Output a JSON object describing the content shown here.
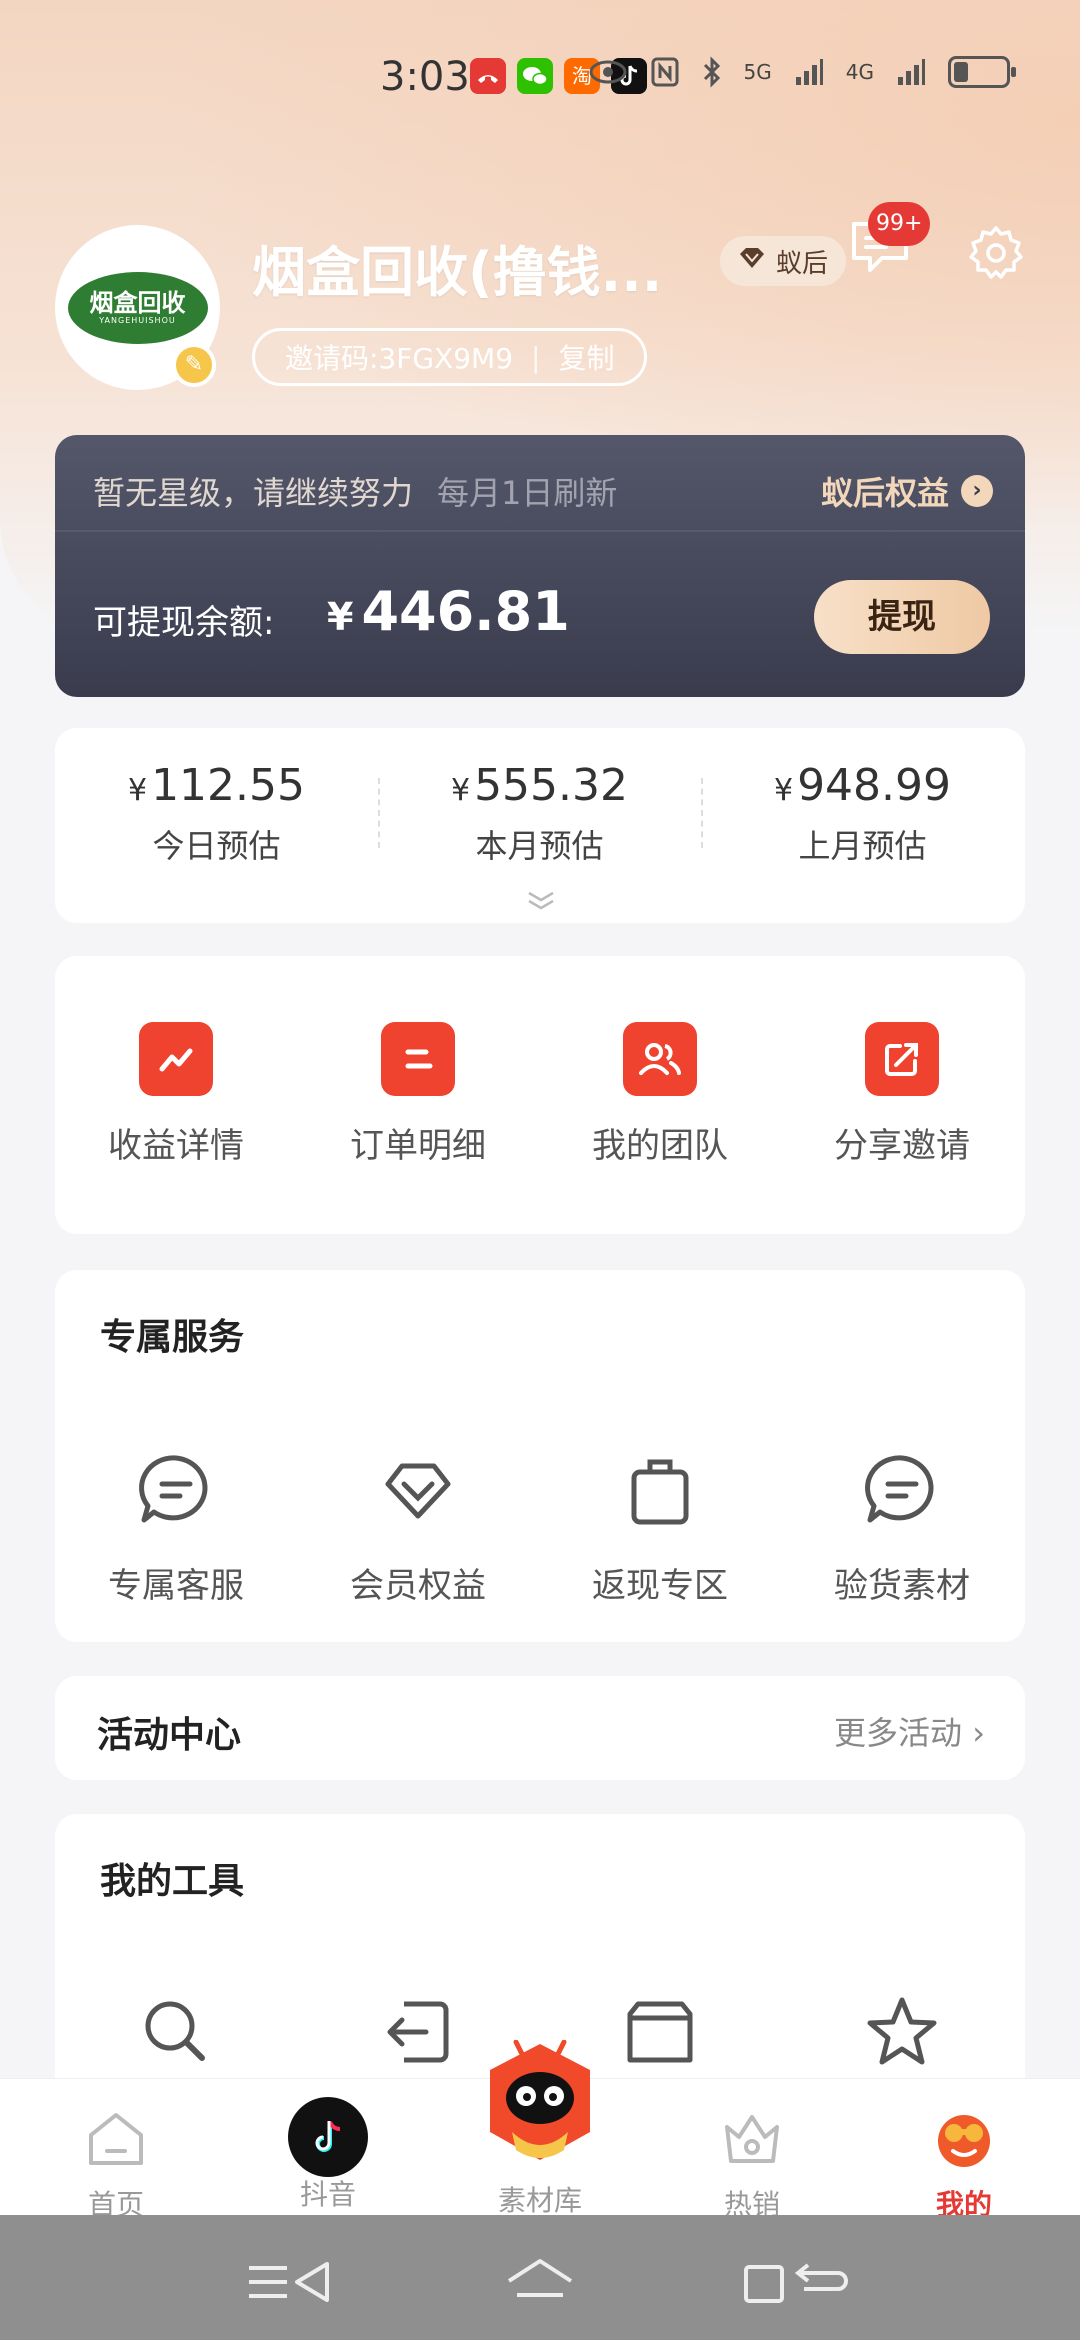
{
  "status_bar": {
    "time": "3:03",
    "apps": [
      "missed-call-icon",
      "wechat-icon",
      "taobao-icon",
      "tiktok-icon"
    ],
    "taobao_glyph": "淘",
    "network": "5G",
    "network2": "4G"
  },
  "profile": {
    "name": "烟盒回收(撸钱...",
    "logo_text": "烟盒回收",
    "logo_subtext": "YANGEHUISHOU",
    "invite_label": "邀请码:3FGX9M9",
    "invite_separator": "|",
    "copy_label": "复制",
    "level": "蚁后",
    "message_badge": "99+"
  },
  "balance_card": {
    "star_note": "暂无星级，请继续努力",
    "refresh_note": "每月1日刷新",
    "rights_label": "蚁后权益",
    "balance_label": "可提现余额:",
    "currency": "¥",
    "balance": "446.81",
    "withdraw_label": "提现"
  },
  "estimates": [
    {
      "currency": "¥",
      "value": "112.55",
      "label": "今日预估"
    },
    {
      "currency": "¥",
      "value": "555.32",
      "label": "本月预估"
    },
    {
      "currency": "¥",
      "value": "948.99",
      "label": "上月预估"
    }
  ],
  "quick_actions": [
    {
      "label": "收益详情",
      "icon": "trend-icon"
    },
    {
      "label": "订单明细",
      "icon": "list-icon"
    },
    {
      "label": "我的团队",
      "icon": "team-icon"
    },
    {
      "label": "分享邀请",
      "icon": "share-icon"
    }
  ],
  "services": {
    "title": "专属服务",
    "items": [
      {
        "label": "专属客服",
        "icon": "chat-bubble-icon"
      },
      {
        "label": "会员权益",
        "icon": "diamond-icon"
      },
      {
        "label": "返现专区",
        "icon": "shopping-bag-icon"
      },
      {
        "label": "验货素材",
        "icon": "chat-bubble-icon"
      }
    ]
  },
  "activity": {
    "title": "活动中心",
    "more_label": "更多活动"
  },
  "tools": {
    "title": "我的工具",
    "items": [
      {
        "icon": "search-icon"
      },
      {
        "icon": "return-icon"
      },
      {
        "icon": "box-icon"
      },
      {
        "icon": "star-icon"
      }
    ]
  },
  "bottom_nav": [
    {
      "label": "首页",
      "icon": "home-icon",
      "active": false
    },
    {
      "label": "抖音",
      "icon": "tiktok-icon",
      "active": false
    },
    {
      "label": "素材库",
      "icon": "mascot-icon",
      "active": false
    },
    {
      "label": "热销",
      "icon": "crown-icon",
      "active": false
    },
    {
      "label": "我的",
      "icon": "mascot-face-icon",
      "active": true
    }
  ],
  "colors": {
    "accent_red": "#f0432f",
    "dark_card": "#3a3c4e",
    "gold": "#f3d7bb",
    "active_nav": "#e53935"
  }
}
